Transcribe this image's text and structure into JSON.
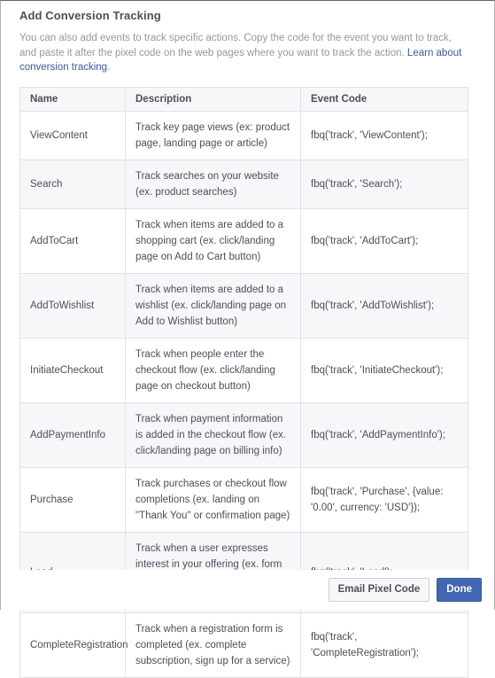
{
  "dialog": {
    "title": "Add Conversion Tracking",
    "intro_text_before_link": "You can also add events to track specific actions. Copy the code for the event you want to track, and paste it after the pixel code on the web pages where you want to track the action. ",
    "intro_link_text": "Learn about conversion tracking",
    "intro_text_after_link": "."
  },
  "table": {
    "headers": {
      "name": "Name",
      "description": "Description",
      "event_code": "Event Code"
    },
    "rows": [
      {
        "name": "ViewContent",
        "description": "Track key page views (ex: product page, landing page or article)",
        "event_code": "fbq('track', 'ViewContent');"
      },
      {
        "name": "Search",
        "description": "Track searches on your website (ex. product searches)",
        "event_code": "fbq('track', 'Search');"
      },
      {
        "name": "AddToCart",
        "description": "Track when items are added to a shopping cart (ex. click/landing page on Add to Cart button)",
        "event_code": "fbq('track', 'AddToCart');"
      },
      {
        "name": "AddToWishlist",
        "description": "Track when items are added to a wishlist (ex. click/landing page on Add to Wishlist button)",
        "event_code": "fbq('track', 'AddToWishlist');"
      },
      {
        "name": "InitiateCheckout",
        "description": "Track when people enter the checkout flow (ex. click/landing page on checkout button)",
        "event_code": "fbq('track', 'InitiateCheckout');"
      },
      {
        "name": "AddPaymentInfo",
        "description": "Track when payment information is added in the checkout flow (ex. click/landing page on billing info)",
        "event_code": "fbq('track', 'AddPaymentInfo');"
      },
      {
        "name": "Purchase",
        "description": "Track purchases or checkout flow completions (ex. landing on \"Thank You\" or confirmation page)",
        "event_code": "fbq('track', 'Purchase', {value: '0.00', currency: 'USD'});"
      },
      {
        "name": "Lead",
        "description": "Track when a user expresses interest in your offering (ex. form submission, sign up for trial, landing on pricing page)",
        "event_code": "fbq('track', 'Lead');"
      },
      {
        "name": "CompleteRegistration",
        "description": "Track when a registration form is completed (ex. complete subscription, sign up for a service)",
        "event_code": "fbq('track', 'CompleteRegistration');"
      }
    ]
  },
  "footer": {
    "email_pixel_code_label": "Email Pixel Code",
    "done_label": "Done"
  },
  "colors": {
    "brand_blue": "#3b5998",
    "primary_button": "#4267b2",
    "text": "#4b4f5c",
    "muted_text": "#9197a3",
    "row_alt": "#f6f7f8",
    "border": "#e0e2e6"
  }
}
